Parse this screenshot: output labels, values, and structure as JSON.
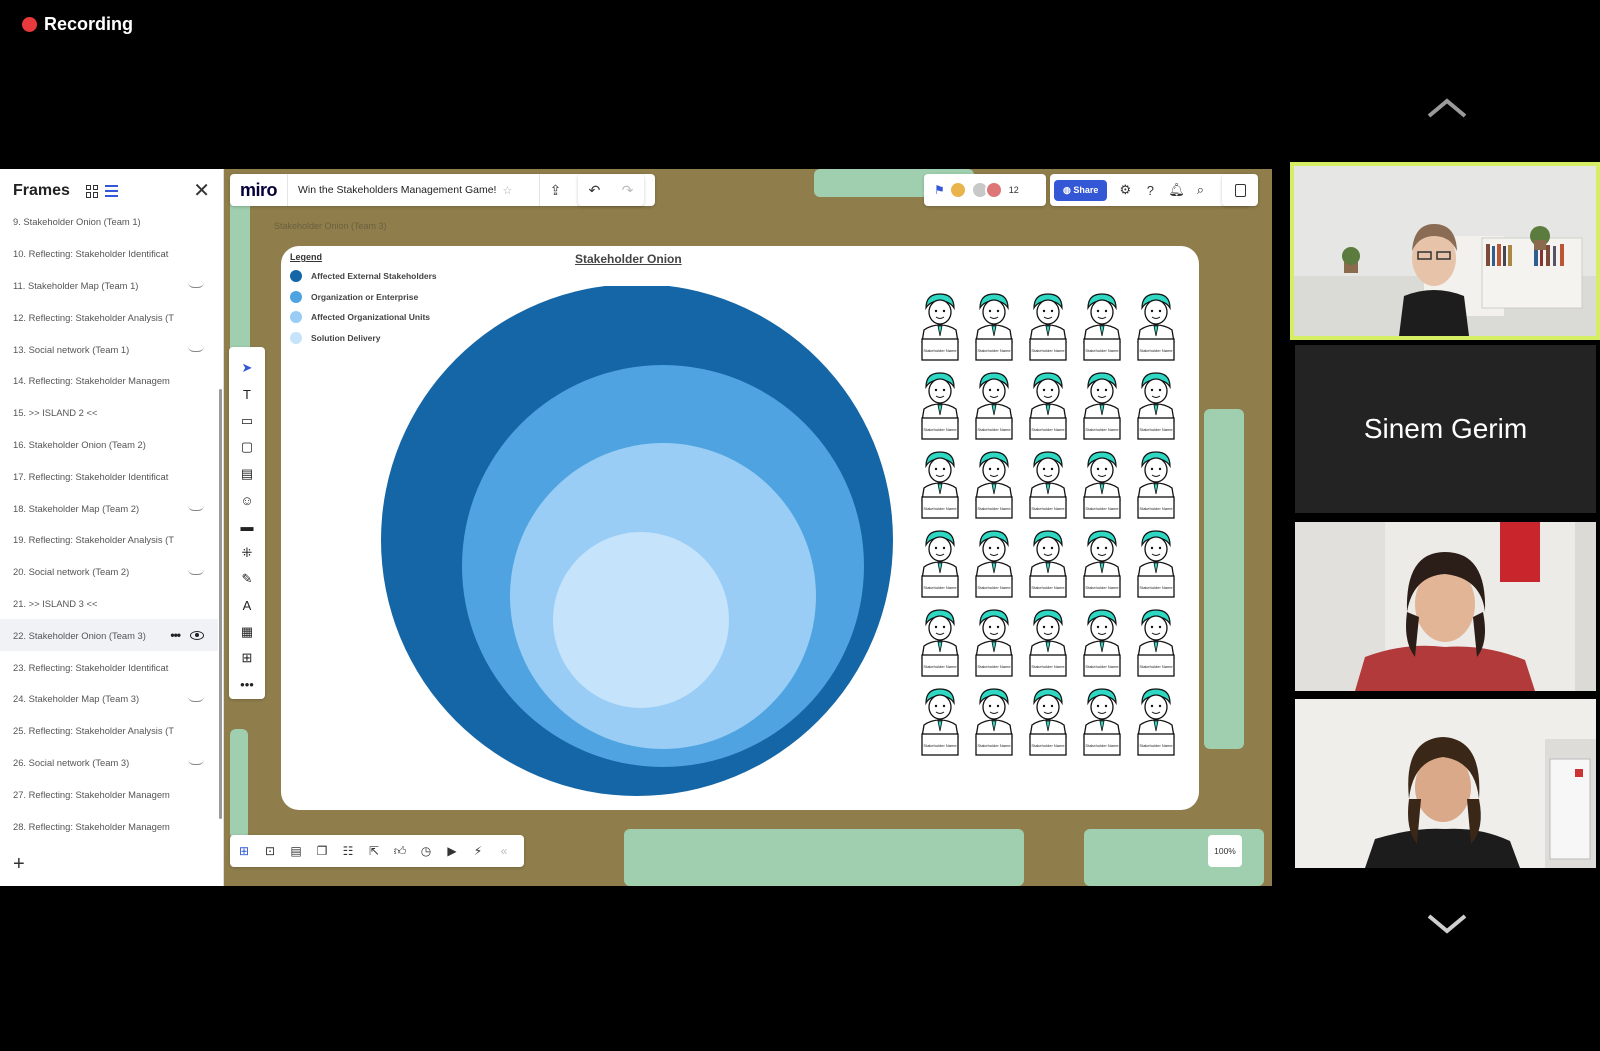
{
  "recording": {
    "label": "Recording"
  },
  "frames_panel": {
    "title": "Frames",
    "items": [
      {
        "label": "9.  Stakeholder Onion (Team 1)",
        "hidden": false
      },
      {
        "label": "10. Reflecting: Stakeholder Identificat",
        "hidden": false
      },
      {
        "label": "11. Stakeholder Map (Team 1)",
        "hidden": true
      },
      {
        "label": "12. Reflecting: Stakeholder Analysis (T",
        "hidden": false
      },
      {
        "label": "13. Social network (Team 1)",
        "hidden": true
      },
      {
        "label": "14. Reflecting: Stakeholder Managem",
        "hidden": false
      },
      {
        "label": "15. >> ISLAND 2 <<",
        "hidden": false
      },
      {
        "label": "16. Stakeholder Onion (Team 2)",
        "hidden": false
      },
      {
        "label": "17. Reflecting: Stakeholder Identificat",
        "hidden": false
      },
      {
        "label": "18. Stakeholder Map (Team 2)",
        "hidden": true
      },
      {
        "label": "19. Reflecting: Stakeholder Analysis (T",
        "hidden": false
      },
      {
        "label": "20. Social network (Team 2)",
        "hidden": true
      },
      {
        "label": "21. >> ISLAND 3 <<",
        "hidden": false
      },
      {
        "label": "22. Stakeholder Onion (Team 3)",
        "hidden": false,
        "active": true
      },
      {
        "label": "23. Reflecting: Stakeholder Identificat",
        "hidden": false
      },
      {
        "label": "24. Stakeholder Map (Team 3)",
        "hidden": true
      },
      {
        "label": "25. Reflecting: Stakeholder Analysis (T",
        "hidden": false
      },
      {
        "label": "26. Social network (Team 3)",
        "hidden": true
      },
      {
        "label": "27. Reflecting: Stakeholder Managem",
        "hidden": false
      },
      {
        "label": "28. Reflecting: Stakeholder Managem",
        "hidden": false
      }
    ],
    "add_label": "+"
  },
  "board": {
    "logo": "miro",
    "title": "Win the Stakeholders Management Game!",
    "collaborator_count": "12",
    "share_label": "Share",
    "frame_caption": "Stakeholder Onion (Team 3)",
    "zoom": "100%"
  },
  "onion": {
    "title": "Stakeholder Onion",
    "legend_title": "Legend",
    "legend": [
      {
        "label": "Affected External Stakeholders",
        "color": "#1466a6"
      },
      {
        "label": "Organization or Enterprise",
        "color": "#4ea3e0"
      },
      {
        "label": "Affected Organizational Units",
        "color": "#99cdf5"
      },
      {
        "label": "Solution Delivery",
        "color": "#c5e3fb"
      }
    ],
    "stakeholder_card_label": "Stakeholder Name",
    "stakeholder_count": 30
  },
  "video": {
    "participant_name": "Sinem Gerim"
  }
}
